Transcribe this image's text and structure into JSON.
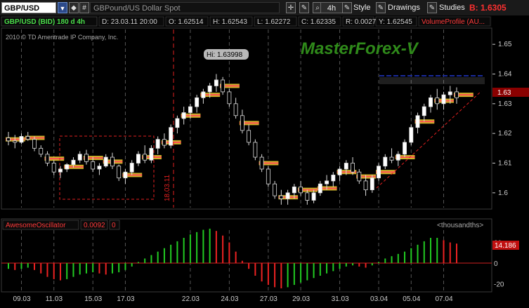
{
  "toolbar": {
    "symbol": "GBP/USD",
    "dropdown_glyph": "▼",
    "description": "GBPound/US Dollar Spot",
    "timeframe": "4h",
    "style_label": "Style",
    "drawings_label": "Drawings",
    "studies_label": "Studies",
    "bid_text": "B: 1.6305"
  },
  "info_bar": {
    "title": "GBP/USD (BID) 180 d 4h",
    "date": "D: 23.03.11 20:00",
    "open": "O: 1.62514",
    "high": "H: 1.62543",
    "low": "L: 1.62272",
    "close": "C: 1.62335",
    "range": "R: 0.00271",
    "y": "Y: 1.62545",
    "volume_profile": "VolumeProfile (AU..."
  },
  "copyright": "2010 © TD Ameritrade IP Company, Inc.",
  "watermark": "MasterForex-V",
  "hi_label": "Hi: 1.63998",
  "vline_label": "18.03.11",
  "price_axis": [
    "1.65",
    "1.64",
    "1.63",
    "1.62",
    "1.61",
    "1.6"
  ],
  "price_marker": "1.63",
  "oscillator": {
    "name": "AwesomeOscillator",
    "value": "0.0092",
    "zero": "0",
    "units": "<thousandths>",
    "axis": [
      "20",
      "0",
      "-20"
    ],
    "current_label": "14.186"
  },
  "x_axis": [
    "09.03",
    "11.03",
    "15.03",
    "17.03",
    "22.03",
    "24.03",
    "27.03",
    "29.03",
    "31.03",
    "03.04",
    "05.04",
    "07.04"
  ],
  "colors": {
    "bull_candle": "#ffffff",
    "bear_candle": "#000000",
    "up_bar": "#22cc22",
    "down_bar": "#ee2222",
    "accent": "#d02020",
    "watermark": "#2f8a1a"
  },
  "chart_data": {
    "type": "candlestick",
    "title": "GBP/USD (BID) 180 d 4h",
    "ylim": [
      1.595,
      1.655
    ],
    "candles": [
      [
        1.6185,
        1.6205,
        1.616,
        1.6175
      ],
      [
        1.6175,
        1.6195,
        1.615,
        1.617
      ],
      [
        1.617,
        1.62,
        1.6165,
        1.619
      ],
      [
        1.619,
        1.6205,
        1.6175,
        1.618
      ],
      [
        1.618,
        1.619,
        1.614,
        1.615
      ],
      [
        1.615,
        1.616,
        1.612,
        1.613
      ],
      [
        1.613,
        1.614,
        1.609,
        1.61
      ],
      [
        1.61,
        1.611,
        1.606,
        1.607
      ],
      [
        1.607,
        1.609,
        1.605,
        1.608
      ],
      [
        1.608,
        1.61,
        1.607,
        1.6095
      ],
      [
        1.6095,
        1.612,
        1.6085,
        1.611
      ],
      [
        1.611,
        1.614,
        1.61,
        1.613
      ],
      [
        1.613,
        1.6145,
        1.6095,
        1.6105
      ],
      [
        1.6105,
        1.612,
        1.607,
        1.608
      ],
      [
        1.608,
        1.61,
        1.606,
        1.609
      ],
      [
        1.609,
        1.613,
        1.6085,
        1.612
      ],
      [
        1.612,
        1.6135,
        1.608,
        1.609
      ],
      [
        1.609,
        1.6095,
        1.604,
        1.605
      ],
      [
        1.605,
        1.608,
        1.603,
        1.607
      ],
      [
        1.607,
        1.611,
        1.606,
        1.61
      ],
      [
        1.61,
        1.614,
        1.609,
        1.613
      ],
      [
        1.613,
        1.616,
        1.61,
        1.611
      ],
      [
        1.611,
        1.616,
        1.61,
        1.615
      ],
      [
        1.615,
        1.619,
        1.613,
        1.618
      ],
      [
        1.618,
        1.62,
        1.615,
        1.616
      ],
      [
        1.616,
        1.623,
        1.615,
        1.622
      ],
      [
        1.622,
        1.626,
        1.62,
        1.625
      ],
      [
        1.625,
        1.629,
        1.623,
        1.627
      ],
      [
        1.627,
        1.63,
        1.625,
        1.629
      ],
      [
        1.629,
        1.633,
        1.627,
        1.632
      ],
      [
        1.632,
        1.635,
        1.63,
        1.634
      ],
      [
        1.634,
        1.637,
        1.632,
        1.636
      ],
      [
        1.636,
        1.64,
        1.634,
        1.638
      ],
      [
        1.638,
        1.639,
        1.633,
        1.634
      ],
      [
        1.634,
        1.635,
        1.629,
        1.63
      ],
      [
        1.63,
        1.632,
        1.625,
        1.626
      ],
      [
        1.626,
        1.628,
        1.62,
        1.621
      ],
      [
        1.621,
        1.623,
        1.616,
        1.617
      ],
      [
        1.617,
        1.618,
        1.611,
        1.612
      ],
      [
        1.612,
        1.613,
        1.607,
        1.608
      ],
      [
        1.608,
        1.609,
        1.602,
        1.603
      ],
      [
        1.603,
        1.604,
        1.598,
        1.599
      ],
      [
        1.599,
        1.601,
        1.596,
        1.598
      ],
      [
        1.598,
        1.601,
        1.596,
        1.6
      ],
      [
        1.6,
        1.603,
        1.598,
        1.602
      ],
      [
        1.602,
        1.604,
        1.599,
        1.6
      ],
      [
        1.6,
        1.601,
        1.596,
        1.5975
      ],
      [
        1.5975,
        1.601,
        1.5965,
        1.6
      ],
      [
        1.6,
        1.604,
        1.599,
        1.603
      ],
      [
        1.603,
        1.606,
        1.601,
        1.604
      ],
      [
        1.604,
        1.607,
        1.602,
        1.606
      ],
      [
        1.606,
        1.609,
        1.604,
        1.608
      ],
      [
        1.608,
        1.611,
        1.606,
        1.61
      ],
      [
        1.61,
        1.612,
        1.606,
        1.607
      ],
      [
        1.607,
        1.608,
        1.603,
        1.604
      ],
      [
        1.604,
        1.606,
        1.599,
        1.601
      ],
      [
        1.601,
        1.606,
        1.6,
        1.605
      ],
      [
        1.605,
        1.61,
        1.604,
        1.609
      ],
      [
        1.609,
        1.613,
        1.608,
        1.612
      ],
      [
        1.612,
        1.615,
        1.61,
        1.611
      ],
      [
        1.611,
        1.614,
        1.609,
        1.613
      ],
      [
        1.613,
        1.618,
        1.612,
        1.617
      ],
      [
        1.617,
        1.623,
        1.616,
        1.622
      ],
      [
        1.622,
        1.627,
        1.62,
        1.626
      ],
      [
        1.626,
        1.63,
        1.624,
        1.629
      ],
      [
        1.629,
        1.633,
        1.627,
        1.632
      ],
      [
        1.632,
        1.635,
        1.628,
        1.63
      ],
      [
        1.63,
        1.634,
        1.628,
        1.633
      ],
      [
        1.633,
        1.636,
        1.63,
        1.634
      ],
      [
        1.634,
        1.6355,
        1.63,
        1.632
      ]
    ],
    "awesome_oscillator": [
      -5,
      -6,
      -5,
      -4,
      -6,
      -9,
      -12,
      -14,
      -15,
      -14,
      -12,
      -10,
      -9,
      -8,
      -9,
      -10,
      -9,
      -8,
      -6,
      -3,
      1,
      4,
      7,
      10,
      13,
      16,
      19,
      22,
      25,
      27,
      29,
      30,
      28,
      24,
      18,
      10,
      2,
      -5,
      -11,
      -16,
      -19,
      -21,
      -22,
      -21,
      -19,
      -17,
      -15,
      -13,
      -11,
      -9,
      -7,
      -5,
      -3,
      -2,
      -3,
      -4,
      -2,
      1,
      4,
      6,
      8,
      10,
      13,
      16,
      19,
      22,
      22,
      20,
      18,
      17
    ]
  }
}
